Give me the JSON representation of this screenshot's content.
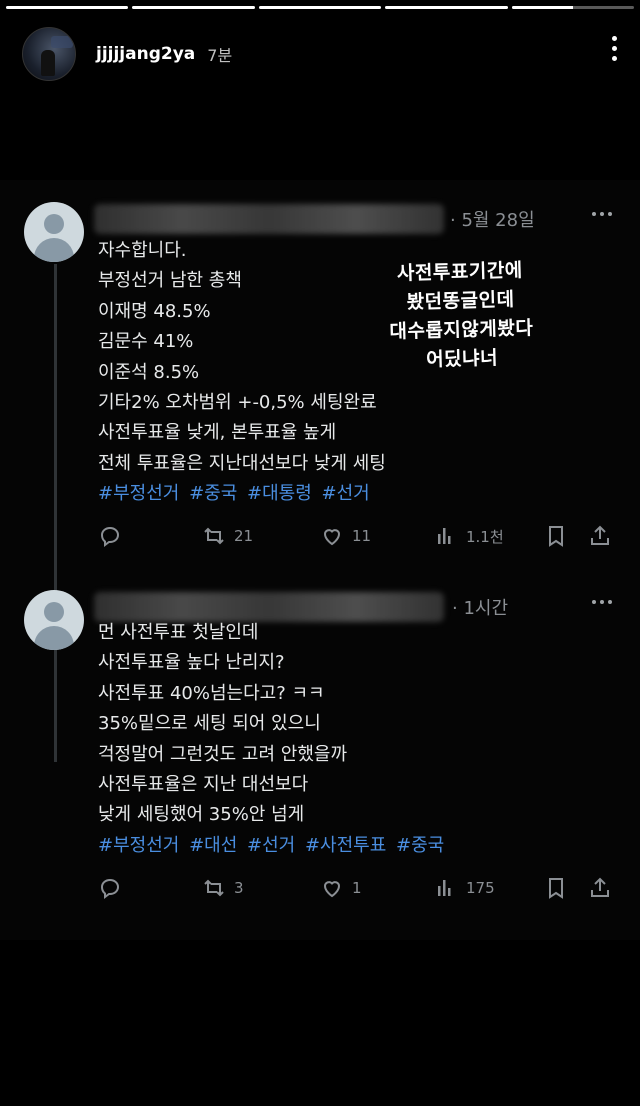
{
  "story": {
    "progress": [
      1.0,
      1.0,
      1.0,
      1.0,
      0.5
    ]
  },
  "header": {
    "username": "jjjjjang2ya",
    "time": "7분"
  },
  "annotation": {
    "lines": [
      "사전투표기간에",
      "봤던똥글인데",
      "대수롭지않게봤다",
      "어딨냐너"
    ]
  },
  "tweets": [
    {
      "date": "· 5월 28일",
      "lines": [
        "자수합니다.",
        "부정선거 남한 총책",
        "이재명 48.5%",
        "김문수 41%",
        "이준석 8.5%",
        "기타2% 오차범위 +-0,5% 세팅완료",
        "사전투표율 낮게, 본투표율 높게",
        "전체 투표율은 지난대선보다 낮게 세팅"
      ],
      "hashtags": [
        "#부정선거",
        "#중국",
        "#대통령",
        "#선거"
      ],
      "retweets": "21",
      "likes": "11",
      "views": "1.1천"
    },
    {
      "date": "· 1시간",
      "lines": [
        "먼 사전투표 첫날인데",
        "사전투표율 높다 난리지?",
        "사전투표 40%넘는다고? ㅋㅋ",
        "35%밑으로 세팅 되어 있으니",
        "걱정말어 그런것도 고려 안했을까",
        "사전투표율은 지난 대선보다",
        "낮게 세팅했어 35%안 넘게"
      ],
      "hashtags": [
        "#부정선거",
        "#대선",
        "#선거",
        "#사전투표",
        "#중국"
      ],
      "retweets": "3",
      "likes": "1",
      "views": "175"
    }
  ]
}
